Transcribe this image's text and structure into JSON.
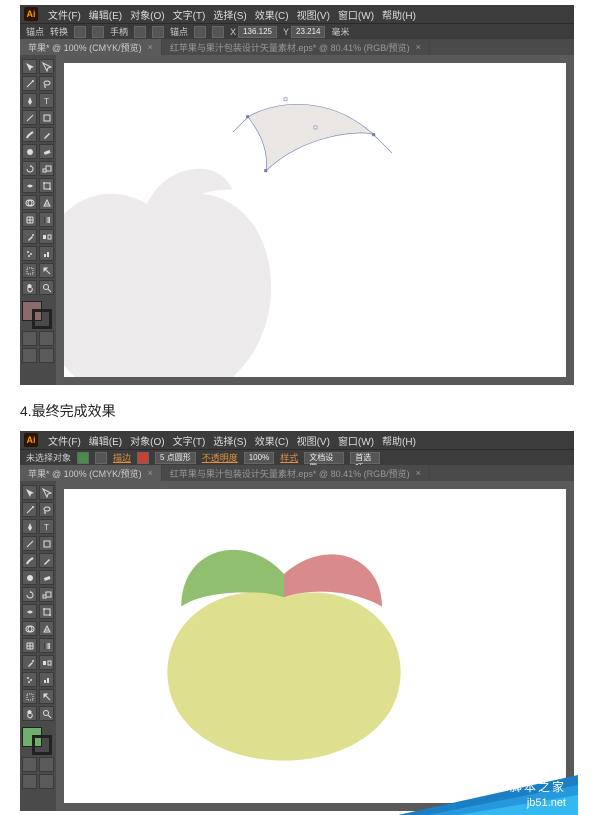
{
  "caption": "4.最终完成效果",
  "watermark": {
    "site": "jb51.net",
    "label": "脚本之家"
  },
  "menu": {
    "items": [
      "文件(F)",
      "编辑(E)",
      "对象(O)",
      "文字(T)",
      "选择(S)",
      "效果(C)",
      "视图(V)",
      "窗口(W)",
      "帮助(H)"
    ]
  },
  "win1": {
    "ctl": {
      "label1": "锚点",
      "label2": "转换",
      "label3": "手柄",
      "label4": "锚点",
      "x": "136.125",
      "y": "23.214",
      "w": "",
      "h": "",
      "unit": "毫米"
    },
    "tab_active": "苹果* @ 100% (CMYK/预览)",
    "tab_inactive": "红苹果与果汁包装设计矢量素材.eps* @ 80.41% (RGB/预览)",
    "swatch_fill": "#8a6b6b"
  },
  "win2": {
    "ctl": {
      "label1": "未选择对象",
      "fillLabel": "填色",
      "strokeLabel": "描边",
      "strokeVal": "5 点圆形",
      "opLabel": "不透明度",
      "op": "100%",
      "styleLabel": "样式",
      "docLabel": "文档设置",
      "prefLabel": "首选项"
    },
    "tab_active": "苹果* @ 100% (CMYK/预览)",
    "tab_inactive": "红苹果与果汁包装设计矢量素材.eps* @ 80.41% (RGB/预览)",
    "swatch_fill": "#6fb06f"
  },
  "tools": [
    [
      "select",
      "direct-select"
    ],
    [
      "magic-wand",
      "lasso"
    ],
    [
      "pen",
      "type"
    ],
    [
      "line",
      "rectangle"
    ],
    [
      "brush",
      "pencil"
    ],
    [
      "blob",
      "eraser"
    ],
    [
      "rotate",
      "scale"
    ],
    [
      "width",
      "free-transform"
    ],
    [
      "shape-builder",
      "perspective"
    ],
    [
      "mesh",
      "gradient"
    ],
    [
      "eyedropper",
      "blend"
    ],
    [
      "symbol-spray",
      "graph"
    ],
    [
      "artboard",
      "slice"
    ],
    [
      "hand",
      "zoom"
    ]
  ],
  "colors": {
    "leaf_green": "#8fbf6f",
    "leaf_red": "#d98a8a",
    "apple_body": "#dfe08f",
    "path_stroke": "#6a7ab0",
    "path_fill": "#d4cdc7"
  }
}
